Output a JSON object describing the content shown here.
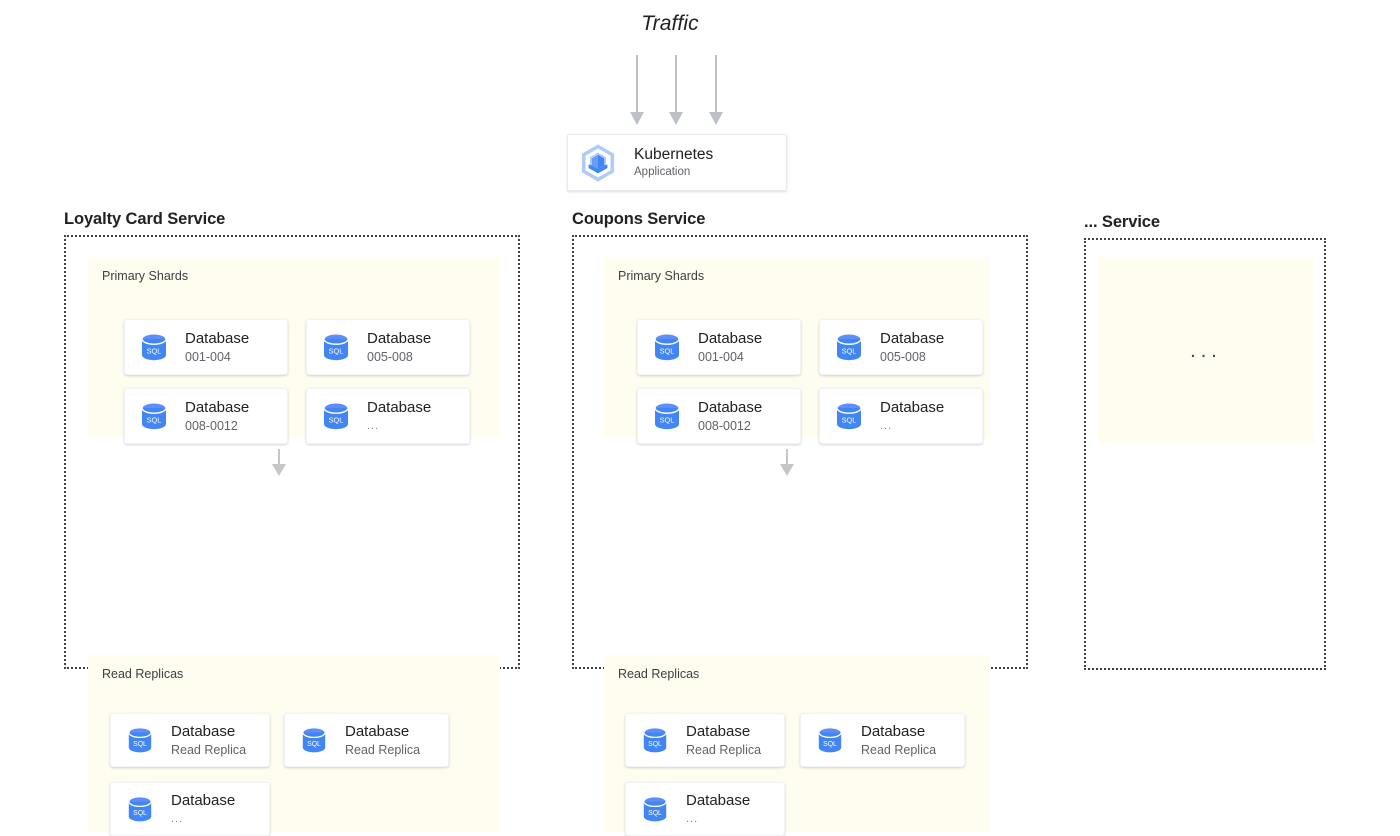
{
  "diagram": {
    "traffic_label": "Traffic",
    "traffic_arrow_count": 3,
    "colors": {
      "db_blue": "#4285F4",
      "k8s_hex": "#AECBFA",
      "panel_bg": "#FFFDF0",
      "arrow_gray": "#BDC1C6",
      "border_dotted": "#3C4043"
    }
  },
  "application": {
    "title": "Kubernetes",
    "subtitle": "Application",
    "icon": "kubernetes-icon"
  },
  "services": [
    {
      "title": "Loyalty Card Service",
      "sections": [
        {
          "label": "Primary Shards",
          "databases": [
            {
              "title": "Database",
              "subtitle": "001-004",
              "icon": "sql-database-icon"
            },
            {
              "title": "Database",
              "subtitle": "005-008",
              "icon": "sql-database-icon"
            },
            {
              "title": "Database",
              "subtitle": "008-0012",
              "icon": "sql-database-icon"
            },
            {
              "title": "Database",
              "subtitle": "...",
              "icon": "sql-database-icon"
            }
          ]
        },
        {
          "label": "Read Replicas",
          "databases": [
            {
              "title": "Database",
              "subtitle": "Read Replica",
              "icon": "sql-database-icon"
            },
            {
              "title": "Database",
              "subtitle": "Read Replica",
              "icon": "sql-database-icon"
            },
            {
              "title": "Database",
              "subtitle": "...",
              "icon": "sql-database-icon"
            }
          ]
        }
      ]
    },
    {
      "title": "Coupons Service",
      "sections": [
        {
          "label": "Primary Shards",
          "databases": [
            {
              "title": "Database",
              "subtitle": "001-004",
              "icon": "sql-database-icon"
            },
            {
              "title": "Database",
              "subtitle": "005-008",
              "icon": "sql-database-icon"
            },
            {
              "title": "Database",
              "subtitle": "008-0012",
              "icon": "sql-database-icon"
            },
            {
              "title": "Database",
              "subtitle": "...",
              "icon": "sql-database-icon"
            }
          ]
        },
        {
          "label": "Read Replicas",
          "databases": [
            {
              "title": "Database",
              "subtitle": "Read Replica",
              "icon": "sql-database-icon"
            },
            {
              "title": "Database",
              "subtitle": "Read Replica",
              "icon": "sql-database-icon"
            },
            {
              "title": "Database",
              "subtitle": "...",
              "icon": "sql-database-icon"
            }
          ]
        }
      ]
    },
    {
      "title": "... Service",
      "placeholder": "..."
    }
  ]
}
